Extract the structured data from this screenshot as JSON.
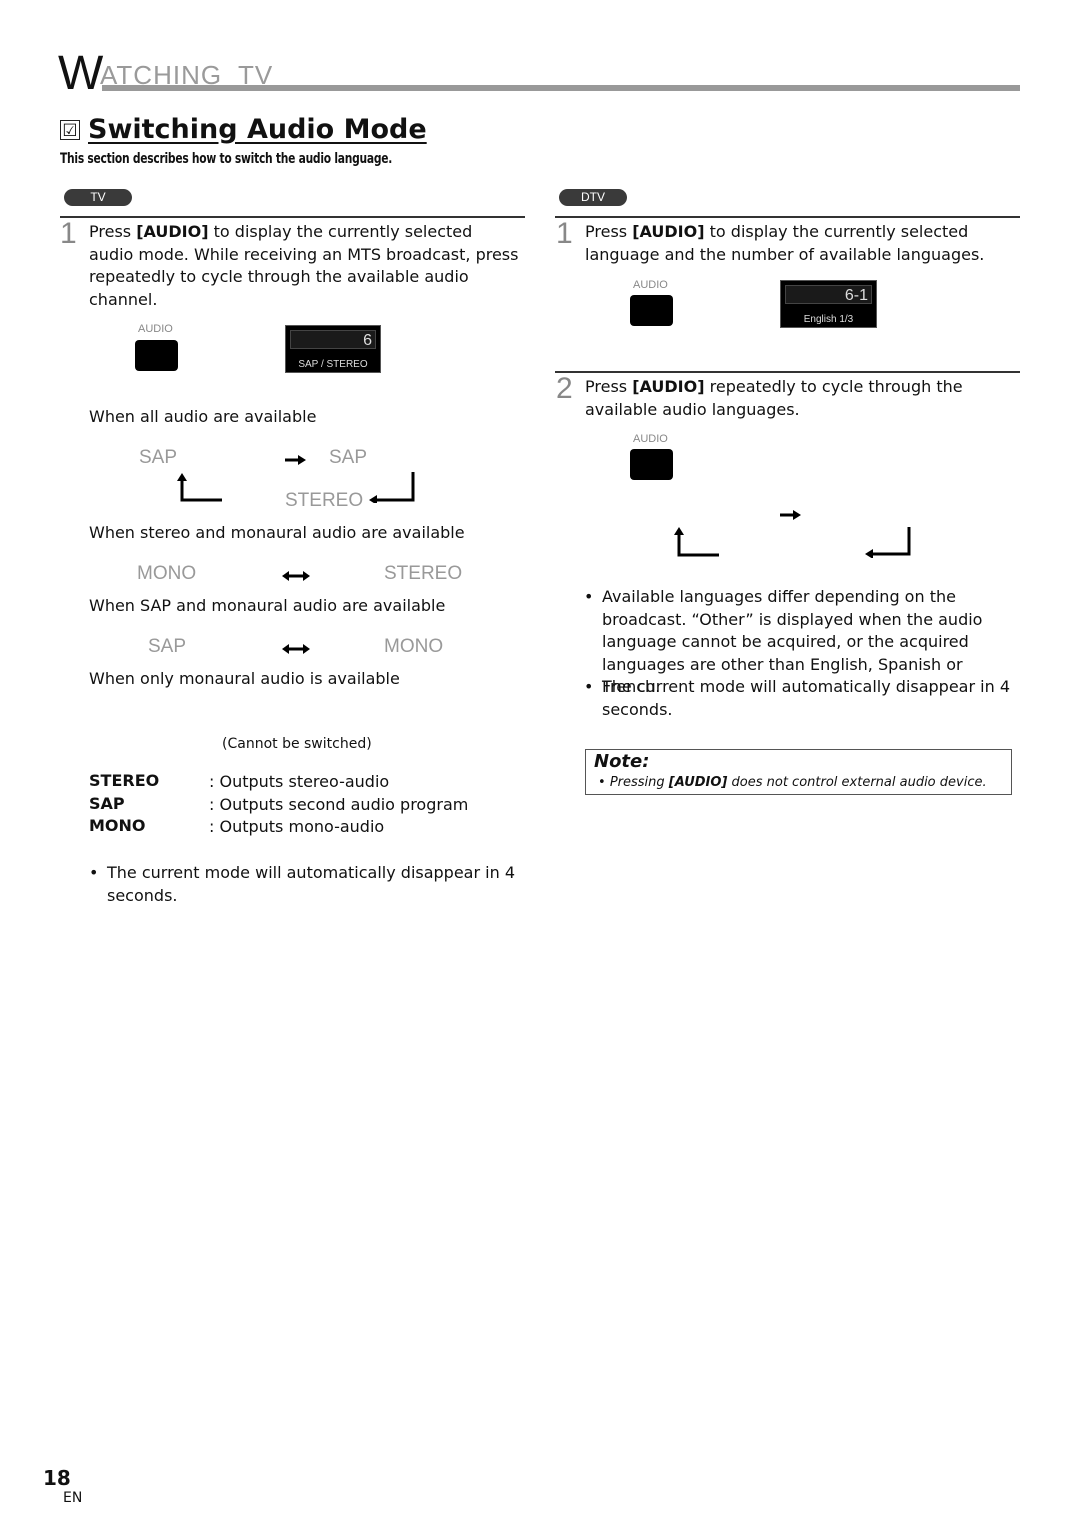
{
  "header": {
    "section_initial": "W",
    "section_rest": "ATCHING  TV"
  },
  "section": {
    "check_icon": "☑",
    "title": "Switching Audio Mode",
    "subtitle": "This section describes how to switch the audio language."
  },
  "tv": {
    "badge": "TV",
    "step1": {
      "num": "1",
      "pre": "Press ",
      "key": "[AUDIO]",
      "post": " to display the currently selected audio mode. While receiving an MTS broadcast, press repeatedly to cycle through the available audio channel."
    },
    "remote_label": "AUDIO",
    "osd": {
      "channel": "6",
      "mode": "SAP / STEREO"
    },
    "cases": [
      {
        "caption": "When all audio are available",
        "items": [
          "SAP",
          "SAP",
          "STEREO"
        ]
      },
      {
        "caption": "When stereo and monaural audio are available",
        "items": [
          "MONO",
          "STEREO"
        ]
      },
      {
        "caption": "When SAP and monaural audio are available",
        "items": [
          "SAP",
          "MONO"
        ]
      },
      {
        "caption": "When only monaural audio is available",
        "note": "(Cannot be switched)"
      }
    ],
    "definitions": [
      {
        "term": "STEREO",
        "desc": ": Outputs stereo-audio"
      },
      {
        "term": "SAP",
        "desc": ": Outputs second audio program"
      },
      {
        "term": "MONO",
        "desc": ": Outputs mono-audio"
      }
    ],
    "bullet": "The current mode will automatically disappear in 4 seconds."
  },
  "dtv": {
    "badge": "DTV",
    "step1": {
      "num": "1",
      "pre": "Press ",
      "key": "[AUDIO]",
      "post": " to display the currently selected language and the number of available languages."
    },
    "remote_label": "AUDIO",
    "osd": {
      "channel": "6-1",
      "language": "English 1/3"
    },
    "step2": {
      "num": "2",
      "pre": "Press ",
      "key": "[AUDIO]",
      "post": " repeatedly to cycle through the available audio languages."
    },
    "remote_label_2": "AUDIO",
    "bullets": [
      "Available languages differ depending on the broadcast. “Other” is displayed when the audio language cannot be acquired, or the acquired languages are other than English, Spanish or French.",
      "The current mode will automatically disappear in 4 seconds."
    ],
    "note": {
      "title": "Note:",
      "pre": "Pressing ",
      "key": "[AUDIO]",
      "post": " does not control external audio device."
    }
  },
  "footer": {
    "page_number": "18",
    "language": "EN"
  }
}
